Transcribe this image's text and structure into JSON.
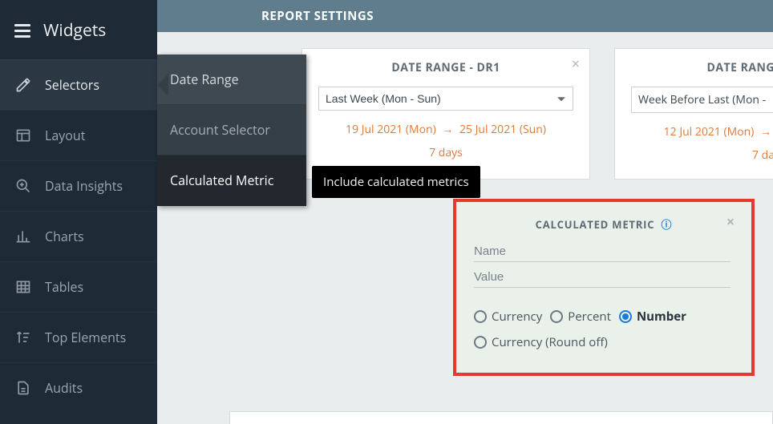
{
  "sidebar": {
    "title": "Widgets",
    "items": [
      {
        "label": "Selectors"
      },
      {
        "label": "Layout"
      },
      {
        "label": "Data Insights"
      },
      {
        "label": "Charts"
      },
      {
        "label": "Tables"
      },
      {
        "label": "Top Elements"
      },
      {
        "label": "Audits"
      }
    ]
  },
  "submenu": {
    "items": [
      {
        "label": "Date Range"
      },
      {
        "label": "Account Selector"
      },
      {
        "label": "Calculated Metric"
      }
    ]
  },
  "tooltip": "Include calculated metrics",
  "topbar": {
    "title": "REPORT SETTINGS"
  },
  "date_ranges": {
    "dr1": {
      "title": "DATE RANGE - DR1",
      "select_value": "Last Week (Mon - Sun)",
      "start": "19 Jul 2021 (Mon)",
      "end": "25 Jul 2021 (Sun)",
      "days": "7 days"
    },
    "dr2": {
      "title": "DATE RANG",
      "select_value": "Week Before Last (Mon -",
      "start": "12 Jul 2021 (Mon)",
      "days": "7 da"
    }
  },
  "calc_metric": {
    "title": "CALCULATED METRIC",
    "name_placeholder": "Name",
    "value_placeholder": "Value",
    "options": {
      "currency": "Currency",
      "percent": "Percent",
      "number": "Number",
      "currency_round": "Currency (Round off)"
    },
    "selected": "number"
  }
}
